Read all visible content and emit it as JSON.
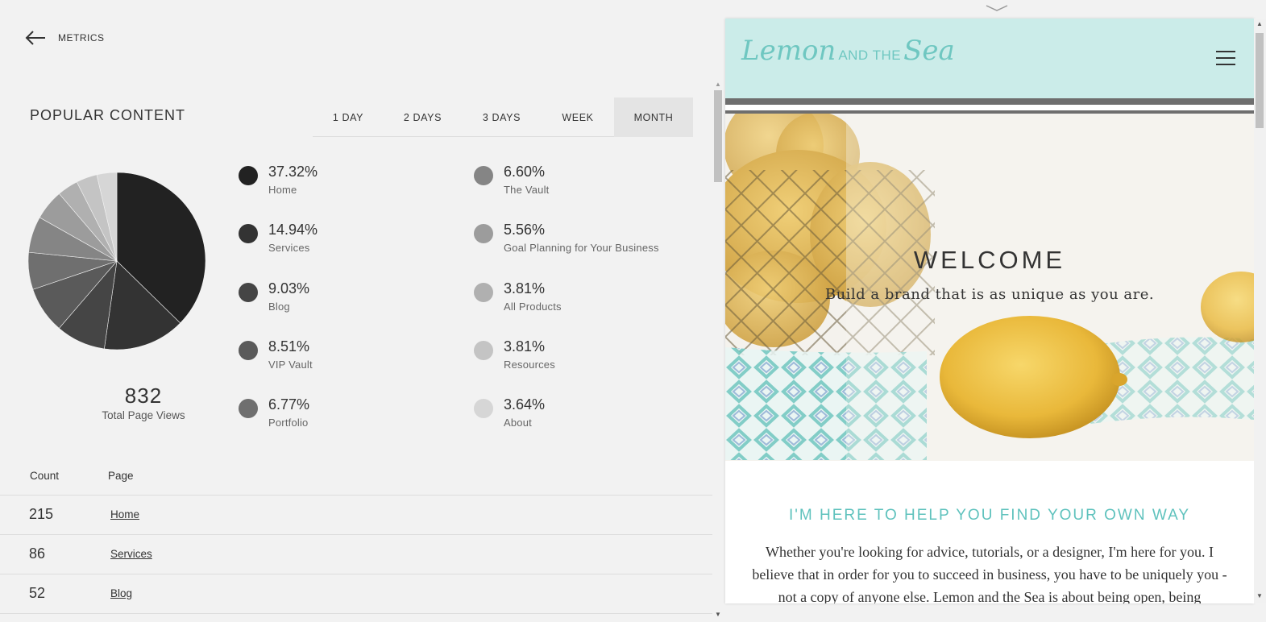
{
  "header": {
    "back_label": "METRICS"
  },
  "popular": {
    "title": "POPULAR CONTENT",
    "tabs": [
      {
        "label": "1 DAY",
        "active": false
      },
      {
        "label": "2 DAYS",
        "active": false
      },
      {
        "label": "3 DAYS",
        "active": false
      },
      {
        "label": "WEEK",
        "active": false
      },
      {
        "label": "MONTH",
        "active": true
      }
    ],
    "total": {
      "value": "832",
      "label": "Total Page Views"
    }
  },
  "chart_data": {
    "type": "pie",
    "title": "",
    "slices": [
      {
        "label": "Home",
        "value": 37.32,
        "percent": "37.32%",
        "color": "#222222"
      },
      {
        "label": "Services",
        "value": 14.94,
        "percent": "14.94%",
        "color": "#333333"
      },
      {
        "label": "Blog",
        "value": 9.03,
        "percent": "9.03%",
        "color": "#454545"
      },
      {
        "label": "VIP Vault",
        "value": 8.51,
        "percent": "8.51%",
        "color": "#5a5a5a"
      },
      {
        "label": "Portfolio",
        "value": 6.77,
        "percent": "6.77%",
        "color": "#6f6f6f"
      },
      {
        "label": "The Vault",
        "value": 6.6,
        "percent": "6.60%",
        "color": "#858585"
      },
      {
        "label": "Goal Planning for Your Business",
        "value": 5.56,
        "percent": "5.56%",
        "color": "#9c9c9c"
      },
      {
        "label": "All Products",
        "value": 3.81,
        "percent": "3.81%",
        "color": "#b0b0b0"
      },
      {
        "label": "Resources",
        "value": 3.81,
        "percent": "3.81%",
        "color": "#c4c4c4"
      },
      {
        "label": "About",
        "value": 3.64,
        "percent": "3.64%",
        "color": "#d6d6d6"
      }
    ]
  },
  "table": {
    "headers": {
      "count": "Count",
      "page": "Page"
    },
    "rows": [
      {
        "count": "215",
        "page": "Home"
      },
      {
        "count": "86",
        "page": "Services"
      },
      {
        "count": "52",
        "page": "Blog"
      }
    ]
  },
  "preview": {
    "logo_main1": "Lemon",
    "logo_small": "AND THE",
    "logo_main2": "Sea",
    "hero_title": "WELCOME",
    "hero_tagline": "Build a brand that is as unique as you are.",
    "section_heading": "I'M HERE TO HELP YOU FIND YOUR OWN WAY",
    "section_body": "Whether you're looking for advice, tutorials, or a designer, I'm here for you. I believe that in order for you to succeed in business, you have to be uniquely you - not a copy of anyone else. Lemon and the Sea is about being open, being",
    "colors": {
      "header_bg": "#cbece9",
      "accent": "#5fc2bd"
    }
  }
}
